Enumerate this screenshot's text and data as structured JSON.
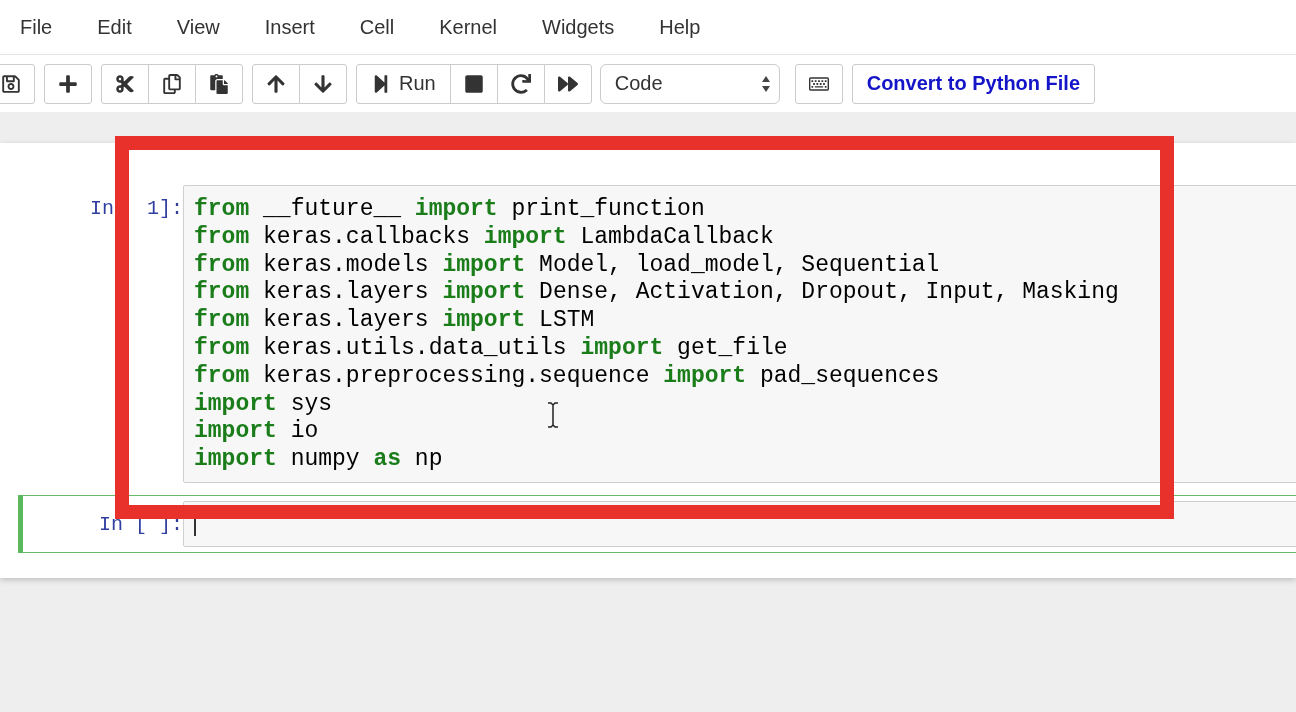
{
  "menu": [
    "File",
    "Edit",
    "View",
    "Insert",
    "Cell",
    "Kernel",
    "Widgets",
    "Help"
  ],
  "toolbar": {
    "run_label": "Run",
    "cell_type": "Code",
    "convert_button": "Convert to Python File"
  },
  "cells": [
    {
      "prompt_parts": [
        "In",
        "1]:"
      ],
      "selected": false,
      "lines": [
        [
          {
            "kind": "keyword",
            "text": "from"
          },
          {
            "kind": "plain",
            "text": " __future__ "
          },
          {
            "kind": "keyword",
            "text": "import"
          },
          {
            "kind": "plain",
            "text": " print_function"
          }
        ],
        [
          {
            "kind": "keyword",
            "text": "from"
          },
          {
            "kind": "plain",
            "text": " keras.callbacks "
          },
          {
            "kind": "keyword",
            "text": "import"
          },
          {
            "kind": "plain",
            "text": " LambdaCallback"
          }
        ],
        [
          {
            "kind": "keyword",
            "text": "from"
          },
          {
            "kind": "plain",
            "text": " keras.models "
          },
          {
            "kind": "keyword",
            "text": "import"
          },
          {
            "kind": "plain",
            "text": " Model, load_model, Sequential"
          }
        ],
        [
          {
            "kind": "keyword",
            "text": "from"
          },
          {
            "kind": "plain",
            "text": " keras.layers "
          },
          {
            "kind": "keyword",
            "text": "import"
          },
          {
            "kind": "plain",
            "text": " Dense, Activation, Dropout, Input, Masking"
          }
        ],
        [
          {
            "kind": "keyword",
            "text": "from"
          },
          {
            "kind": "plain",
            "text": " keras.layers "
          },
          {
            "kind": "keyword",
            "text": "import"
          },
          {
            "kind": "plain",
            "text": " LSTM"
          }
        ],
        [
          {
            "kind": "keyword",
            "text": "from"
          },
          {
            "kind": "plain",
            "text": " keras.utils.data_utils "
          },
          {
            "kind": "keyword",
            "text": "import"
          },
          {
            "kind": "plain",
            "text": " get_file"
          }
        ],
        [
          {
            "kind": "keyword",
            "text": "from"
          },
          {
            "kind": "plain",
            "text": " keras.preprocessing.sequence "
          },
          {
            "kind": "keyword",
            "text": "import"
          },
          {
            "kind": "plain",
            "text": " pad_sequences"
          }
        ],
        [
          {
            "kind": "keyword",
            "text": "import"
          },
          {
            "kind": "plain",
            "text": " sys"
          }
        ],
        [
          {
            "kind": "keyword",
            "text": "import"
          },
          {
            "kind": "plain",
            "text": " io"
          }
        ],
        [
          {
            "kind": "keyword",
            "text": "import"
          },
          {
            "kind": "plain",
            "text": " numpy "
          },
          {
            "kind": "keyword",
            "text": "as"
          },
          {
            "kind": "plain",
            "text": " np"
          }
        ]
      ]
    },
    {
      "prompt_parts": [
        "In [ ]:"
      ],
      "selected": true
    }
  ]
}
